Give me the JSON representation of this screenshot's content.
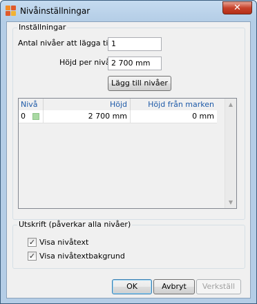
{
  "window": {
    "title": "Nivåinställningar",
    "close_glyph": "✕"
  },
  "settings": {
    "group_title": "Inställningar",
    "levels_to_add_label": "Antal nivåer att lägga till",
    "levels_to_add_value": "1",
    "height_per_level_label": "Höjd per nivå",
    "height_per_level_value": "2 700 mm",
    "add_levels_button": "Lägg till nivåer"
  },
  "levels_table": {
    "columns": [
      "Nivå",
      "Höjd",
      "Höjd från marken"
    ],
    "rows": [
      {
        "level": "0",
        "color": "#a9d9a3",
        "height": "2 700 mm",
        "height_from_ground": "0 mm"
      }
    ],
    "scroll_up_glyph": "▲",
    "scroll_down_glyph": "▼"
  },
  "printout": {
    "group_title": "Utskrift (påverkar alla nivåer)",
    "show_level_text": {
      "label": "Visa nivåtext",
      "checked": true,
      "mark": "✓"
    },
    "show_level_text_background": {
      "label": "Visa nivåtextbakgrund",
      "checked": true,
      "mark": "✓"
    }
  },
  "buttons": {
    "ok": "OK",
    "cancel": "Avbryt",
    "apply": "Verkställ"
  },
  "icons": {
    "app": "levels-app-icon",
    "close": "close-icon"
  }
}
